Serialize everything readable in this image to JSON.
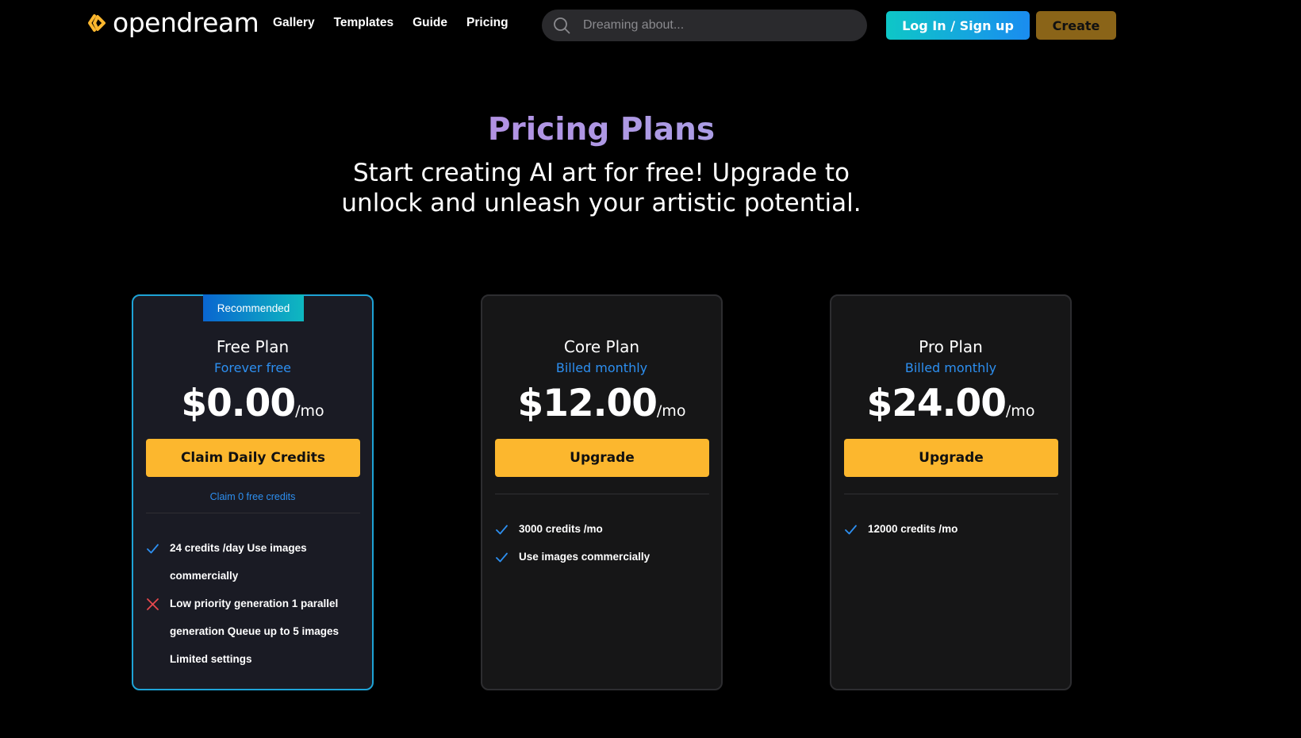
{
  "header": {
    "logo_text": "opendream",
    "nav": [
      "Gallery",
      "Templates",
      "Guide",
      "Pricing"
    ],
    "search_placeholder": "Dreaming about...",
    "login_label": "Log In / Sign up",
    "create_label": "Create"
  },
  "hero": {
    "title": "Pricing Plans",
    "subtitle": "Start creating AI art for free! Upgrade to unlock and unleash your artistic potential."
  },
  "plans": [
    {
      "badge": "Recommended",
      "name": "Free Plan",
      "billing": "Forever free",
      "price": "$0.00",
      "unit": "/mo",
      "cta": "Claim Daily Credits",
      "note": "Claim 0 free credits",
      "features": [
        {
          "text": "24 credits /day Use images commercially",
          "included": true
        },
        {
          "text": "Low priority generation 1 parallel generation Queue up to 5 images Limited settings",
          "included": false
        }
      ]
    },
    {
      "name": "Core Plan",
      "billing": "Billed monthly",
      "price": "$12.00",
      "unit": "/mo",
      "cta": "Upgrade",
      "features": [
        {
          "text": "3000 credits /mo",
          "included": true
        },
        {
          "text": "Use images commercially",
          "included": true
        }
      ]
    },
    {
      "name": "Pro Plan",
      "billing": "Billed monthly",
      "price": "$24.00",
      "unit": "/mo",
      "cta": "Upgrade",
      "features": [
        {
          "text": "12000 credits /mo",
          "included": true
        }
      ]
    }
  ],
  "colors": {
    "accent_blue": "#2d8ff0",
    "cta_yellow": "#fcb72e",
    "create_gold": "#8a6418",
    "check_blue": "#2d8ff0",
    "cross_red": "#e5484d"
  }
}
